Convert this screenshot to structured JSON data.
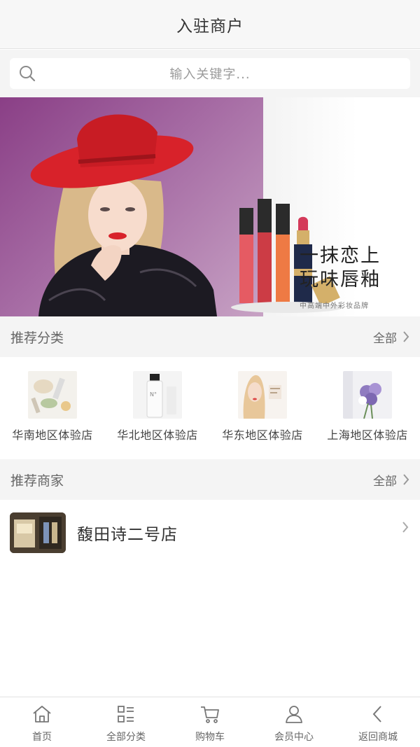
{
  "header": {
    "title": "入驻商户"
  },
  "search": {
    "placeholder": "输入关键字..."
  },
  "banner": {
    "headline_line1": "一抹恋上",
    "headline_line2": "玩味唇釉",
    "sub": "中高端中外彩妆品牌"
  },
  "recommended_categories": {
    "label": "推荐分类",
    "more": "全部",
    "items": [
      {
        "label": "华南地区体验店",
        "icon": "products-flatlay-thumb"
      },
      {
        "label": "华北地区体验店",
        "icon": "bottle-thumb"
      },
      {
        "label": "华东地区体验店",
        "icon": "model-portrait-thumb"
      },
      {
        "label": "上海地区体验店",
        "icon": "bouquet-thumb"
      }
    ]
  },
  "recommended_merchants": {
    "label": "推荐商家",
    "more": "全部",
    "items": [
      {
        "name": "馥田诗二号店",
        "icon": "storefront-thumb"
      }
    ]
  },
  "tabbar": {
    "items": [
      {
        "label": "首页",
        "icon": "home-icon"
      },
      {
        "label": "全部分类",
        "icon": "category-icon"
      },
      {
        "label": "购物车",
        "icon": "cart-icon"
      },
      {
        "label": "会员中心",
        "icon": "user-icon"
      },
      {
        "label": "返回商城",
        "icon": "back-icon"
      }
    ]
  },
  "colors": {
    "banner_purple": "#8a3f86",
    "hat_red": "#d8222a",
    "section_bg": "#f4f4f4",
    "text_gray": "#666666"
  }
}
